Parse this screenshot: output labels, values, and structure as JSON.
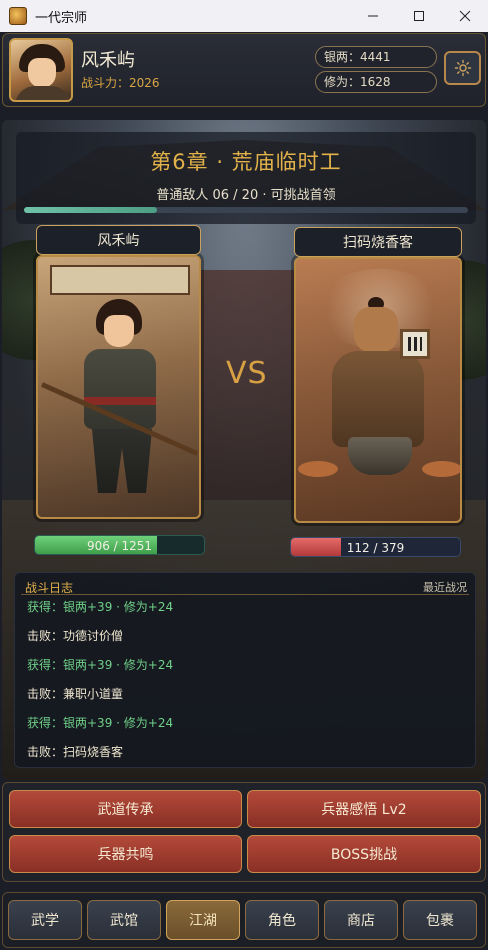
{
  "window": {
    "title": "一代宗师"
  },
  "player": {
    "name": "风禾屿",
    "power_label": "战斗力：2026",
    "silver_label": "银两：4441",
    "cultivation_label": "修为：1628"
  },
  "chapter": {
    "title": "第6章 · 荒庙临时工",
    "subtitle": "普通敌人 06 / 20 · 可挑战首领",
    "progress": 0.3
  },
  "battle": {
    "hero": {
      "name": "风禾屿",
      "hp_text": "906 / 1251",
      "hp_fraction": 0.724
    },
    "enemy": {
      "name": "扫码烧香客",
      "hp_text": "112 / 379",
      "hp_fraction": 0.296
    },
    "vs": "VS"
  },
  "log": {
    "title": "战斗日志",
    "recent_label": "最近战况",
    "lines": [
      {
        "type": "gain",
        "text": "获得：银两+39 · 修为+24"
      },
      {
        "type": "defeat",
        "text": "击败：功德讨价僧"
      },
      {
        "type": "gain",
        "text": "获得：银两+39 · 修为+24"
      },
      {
        "type": "defeat",
        "text": "击败：兼职小道童"
      },
      {
        "type": "gain",
        "text": "获得：银两+39 · 修为+24"
      },
      {
        "type": "defeat",
        "text": "击败：扫码烧香客"
      }
    ]
  },
  "actions": [
    {
      "label": "武道传承"
    },
    {
      "label": "兵器感悟 Lv2"
    },
    {
      "label": "兵器共鸣"
    },
    {
      "label": "BOSS挑战"
    }
  ],
  "nav": [
    {
      "label": "武学",
      "active": false
    },
    {
      "label": "武馆",
      "active": false
    },
    {
      "label": "江湖",
      "active": true
    },
    {
      "label": "角色",
      "active": false
    },
    {
      "label": "商店",
      "active": false
    },
    {
      "label": "包裹",
      "active": false
    }
  ],
  "icons": {
    "app": "game-app-icon",
    "settings": "gear-icon",
    "minimize": "minimize-icon",
    "maximize": "maximize-icon",
    "close": "close-icon"
  },
  "colors": {
    "accent_gold": "#e3b24a",
    "hp_hero": "#4fb25c",
    "hp_enemy": "#d04a4a",
    "log_gain": "#6fd088",
    "action_red": "#9b3a2e"
  }
}
